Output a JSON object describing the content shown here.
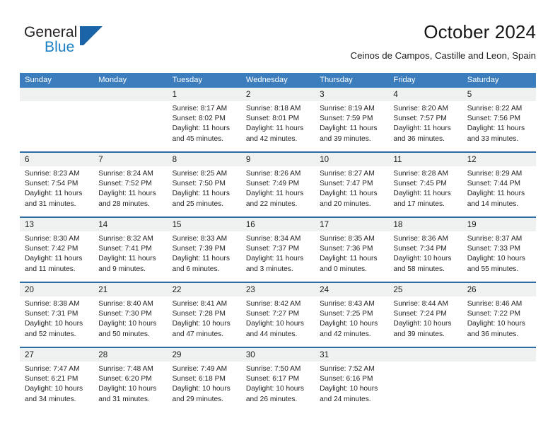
{
  "brand": {
    "name_line1": "General",
    "name_line2": "Blue",
    "flag_icon": "flag-triangle-icon",
    "accent_color": "#1b64a8",
    "text_color": "#231f20"
  },
  "header": {
    "month_title": "October 2024",
    "location": "Ceinos de Campos, Castille and Leon, Spain"
  },
  "theme": {
    "header_blue": "#3b7dbd",
    "separator_blue": "#2e6da4",
    "date_band_gray": "#eff0f0",
    "body_text": "#242424"
  },
  "calendar": {
    "weekdays": [
      "Sunday",
      "Monday",
      "Tuesday",
      "Wednesday",
      "Thursday",
      "Friday",
      "Saturday"
    ],
    "weeks": [
      [
        {
          "day": "",
          "lines": []
        },
        {
          "day": "",
          "lines": []
        },
        {
          "day": "1",
          "lines": [
            "Sunrise: 8:17 AM",
            "Sunset: 8:02 PM",
            "Daylight: 11 hours",
            "and 45 minutes."
          ]
        },
        {
          "day": "2",
          "lines": [
            "Sunrise: 8:18 AM",
            "Sunset: 8:01 PM",
            "Daylight: 11 hours",
            "and 42 minutes."
          ]
        },
        {
          "day": "3",
          "lines": [
            "Sunrise: 8:19 AM",
            "Sunset: 7:59 PM",
            "Daylight: 11 hours",
            "and 39 minutes."
          ]
        },
        {
          "day": "4",
          "lines": [
            "Sunrise: 8:20 AM",
            "Sunset: 7:57 PM",
            "Daylight: 11 hours",
            "and 36 minutes."
          ]
        },
        {
          "day": "5",
          "lines": [
            "Sunrise: 8:22 AM",
            "Sunset: 7:56 PM",
            "Daylight: 11 hours",
            "and 33 minutes."
          ]
        }
      ],
      [
        {
          "day": "6",
          "lines": [
            "Sunrise: 8:23 AM",
            "Sunset: 7:54 PM",
            "Daylight: 11 hours",
            "and 31 minutes."
          ]
        },
        {
          "day": "7",
          "lines": [
            "Sunrise: 8:24 AM",
            "Sunset: 7:52 PM",
            "Daylight: 11 hours",
            "and 28 minutes."
          ]
        },
        {
          "day": "8",
          "lines": [
            "Sunrise: 8:25 AM",
            "Sunset: 7:50 PM",
            "Daylight: 11 hours",
            "and 25 minutes."
          ]
        },
        {
          "day": "9",
          "lines": [
            "Sunrise: 8:26 AM",
            "Sunset: 7:49 PM",
            "Daylight: 11 hours",
            "and 22 minutes."
          ]
        },
        {
          "day": "10",
          "lines": [
            "Sunrise: 8:27 AM",
            "Sunset: 7:47 PM",
            "Daylight: 11 hours",
            "and 20 minutes."
          ]
        },
        {
          "day": "11",
          "lines": [
            "Sunrise: 8:28 AM",
            "Sunset: 7:45 PM",
            "Daylight: 11 hours",
            "and 17 minutes."
          ]
        },
        {
          "day": "12",
          "lines": [
            "Sunrise: 8:29 AM",
            "Sunset: 7:44 PM",
            "Daylight: 11 hours",
            "and 14 minutes."
          ]
        }
      ],
      [
        {
          "day": "13",
          "lines": [
            "Sunrise: 8:30 AM",
            "Sunset: 7:42 PM",
            "Daylight: 11 hours",
            "and 11 minutes."
          ]
        },
        {
          "day": "14",
          "lines": [
            "Sunrise: 8:32 AM",
            "Sunset: 7:41 PM",
            "Daylight: 11 hours",
            "and 9 minutes."
          ]
        },
        {
          "day": "15",
          "lines": [
            "Sunrise: 8:33 AM",
            "Sunset: 7:39 PM",
            "Daylight: 11 hours",
            "and 6 minutes."
          ]
        },
        {
          "day": "16",
          "lines": [
            "Sunrise: 8:34 AM",
            "Sunset: 7:37 PM",
            "Daylight: 11 hours",
            "and 3 minutes."
          ]
        },
        {
          "day": "17",
          "lines": [
            "Sunrise: 8:35 AM",
            "Sunset: 7:36 PM",
            "Daylight: 11 hours",
            "and 0 minutes."
          ]
        },
        {
          "day": "18",
          "lines": [
            "Sunrise: 8:36 AM",
            "Sunset: 7:34 PM",
            "Daylight: 10 hours",
            "and 58 minutes."
          ]
        },
        {
          "day": "19",
          "lines": [
            "Sunrise: 8:37 AM",
            "Sunset: 7:33 PM",
            "Daylight: 10 hours",
            "and 55 minutes."
          ]
        }
      ],
      [
        {
          "day": "20",
          "lines": [
            "Sunrise: 8:38 AM",
            "Sunset: 7:31 PM",
            "Daylight: 10 hours",
            "and 52 minutes."
          ]
        },
        {
          "day": "21",
          "lines": [
            "Sunrise: 8:40 AM",
            "Sunset: 7:30 PM",
            "Daylight: 10 hours",
            "and 50 minutes."
          ]
        },
        {
          "day": "22",
          "lines": [
            "Sunrise: 8:41 AM",
            "Sunset: 7:28 PM",
            "Daylight: 10 hours",
            "and 47 minutes."
          ]
        },
        {
          "day": "23",
          "lines": [
            "Sunrise: 8:42 AM",
            "Sunset: 7:27 PM",
            "Daylight: 10 hours",
            "and 44 minutes."
          ]
        },
        {
          "day": "24",
          "lines": [
            "Sunrise: 8:43 AM",
            "Sunset: 7:25 PM",
            "Daylight: 10 hours",
            "and 42 minutes."
          ]
        },
        {
          "day": "25",
          "lines": [
            "Sunrise: 8:44 AM",
            "Sunset: 7:24 PM",
            "Daylight: 10 hours",
            "and 39 minutes."
          ]
        },
        {
          "day": "26",
          "lines": [
            "Sunrise: 8:46 AM",
            "Sunset: 7:22 PM",
            "Daylight: 10 hours",
            "and 36 minutes."
          ]
        }
      ],
      [
        {
          "day": "27",
          "lines": [
            "Sunrise: 7:47 AM",
            "Sunset: 6:21 PM",
            "Daylight: 10 hours",
            "and 34 minutes."
          ]
        },
        {
          "day": "28",
          "lines": [
            "Sunrise: 7:48 AM",
            "Sunset: 6:20 PM",
            "Daylight: 10 hours",
            "and 31 minutes."
          ]
        },
        {
          "day": "29",
          "lines": [
            "Sunrise: 7:49 AM",
            "Sunset: 6:18 PM",
            "Daylight: 10 hours",
            "and 29 minutes."
          ]
        },
        {
          "day": "30",
          "lines": [
            "Sunrise: 7:50 AM",
            "Sunset: 6:17 PM",
            "Daylight: 10 hours",
            "and 26 minutes."
          ]
        },
        {
          "day": "31",
          "lines": [
            "Sunrise: 7:52 AM",
            "Sunset: 6:16 PM",
            "Daylight: 10 hours",
            "and 24 minutes."
          ]
        },
        {
          "day": "",
          "lines": []
        },
        {
          "day": "",
          "lines": []
        }
      ]
    ]
  }
}
